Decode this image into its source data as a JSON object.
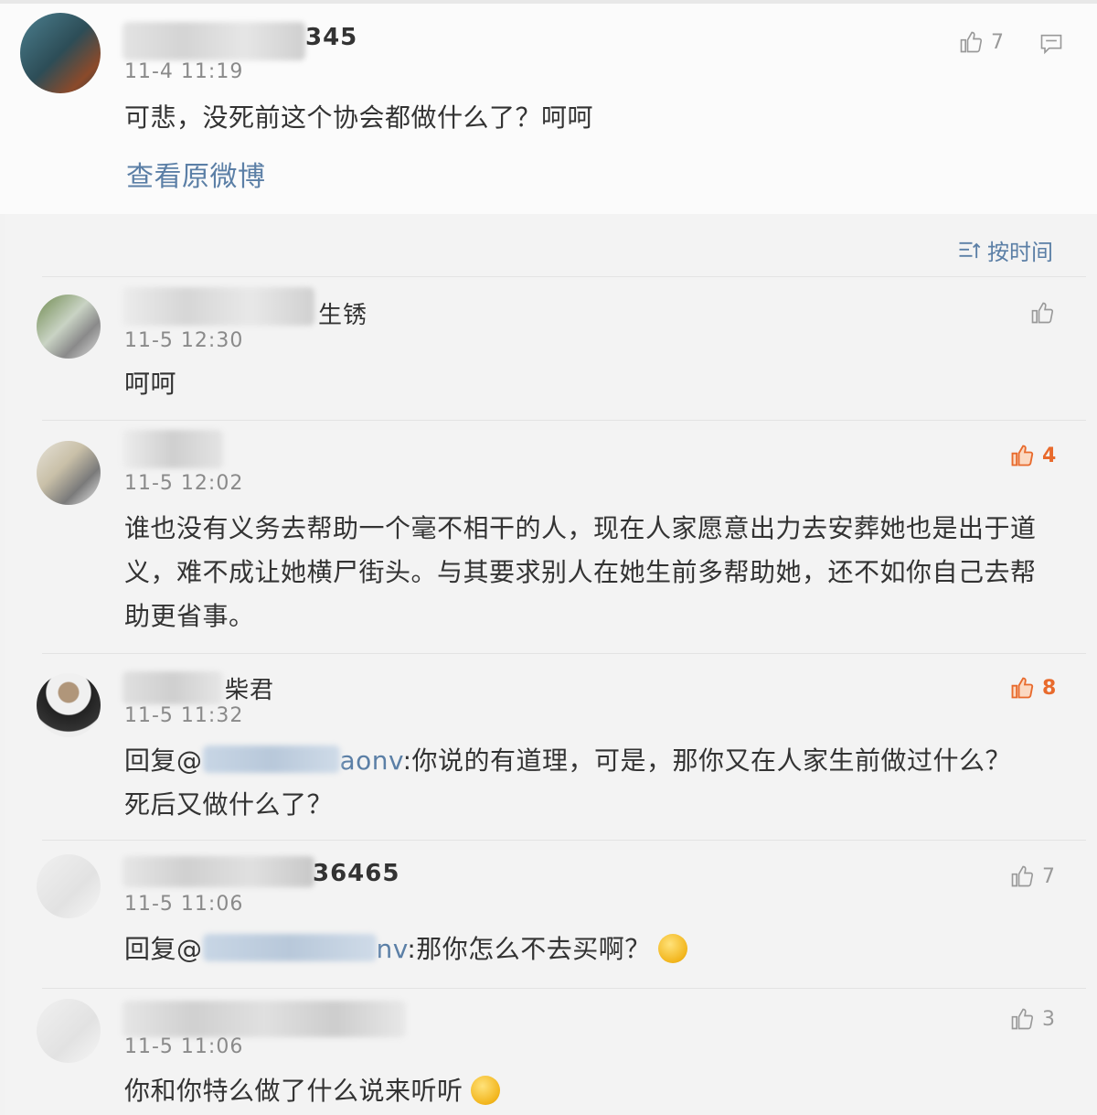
{
  "original_post": {
    "username_visible": "345",
    "date": "11-4 11:19",
    "text": "可悲，没死前这个协会都做什么了？呵呵",
    "view_original": "查看原微博",
    "likes": "7"
  },
  "sort_label": "按时间",
  "comments": [
    {
      "username_visible": "生锈",
      "date": "11-5 12:30",
      "text": "呵呵",
      "likes": ""
    },
    {
      "username_visible": "",
      "date": "11-5 12:02",
      "text": "谁也没有义务去帮助一个毫不相干的人，现在人家愿意出力去安葬她也是出于道义，难不成让她横尸街头。与其要求别人在她生前多帮助她，还不如你自己去帮助更省事。",
      "likes": "4"
    },
    {
      "username_visible": "柴君",
      "date": "11-5 11:32",
      "reply_prefix": "回复@",
      "reply_target": "aonv",
      "text": ":你说的有道理，可是，那你又在人家生前做过什么？死后又做什么了？",
      "likes": "8"
    },
    {
      "username_visible": "36465",
      "date": "11-5 11:06",
      "reply_prefix": "回复@",
      "reply_target": "nv",
      "text": ":那你怎么不去买啊？",
      "likes": "7"
    },
    {
      "username_visible": "",
      "date": "11-5 11:06",
      "text": "你和你特么做了什么说来听听",
      "likes": "3"
    }
  ],
  "colors": {
    "accent_link": "#5b7fa6",
    "like_active": "#e86a2c",
    "muted": "#8a8a8a"
  },
  "icons": [
    "thumbs-up-icon",
    "comment-icon",
    "sort-icon",
    "emoji-icon"
  ]
}
